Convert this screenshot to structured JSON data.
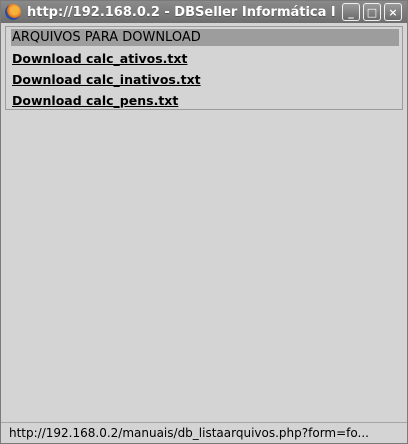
{
  "window": {
    "title": "http://192.168.0.2 - DBSeller Informática l",
    "buttons": {
      "minimize": "_",
      "maximize": "□",
      "close": "×"
    }
  },
  "panel": {
    "header": "ARQUIVOS PARA DOWNLOAD",
    "links": [
      "Download calc_ativos.txt",
      "Download calc_inativos.txt",
      "Download calc_pens.txt"
    ]
  },
  "statusbar": {
    "text": "http://192.168.0.2/manuais/db_listaarquivos.php?form=fo..."
  },
  "colors": {
    "titlebar": "#7a7a7a",
    "background": "#d4d4d4",
    "header_bg": "#9d9d9d"
  },
  "icons": [
    "firefox-icon",
    "minimize-icon",
    "maximize-icon",
    "close-icon"
  ]
}
